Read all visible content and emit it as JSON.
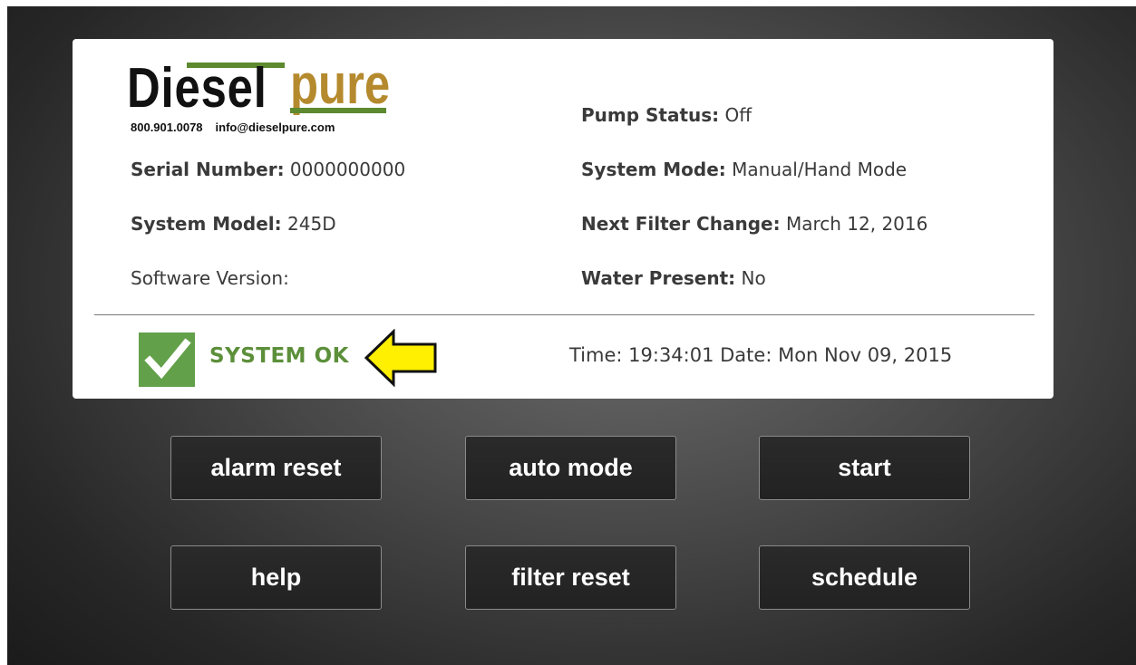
{
  "brand": {
    "name_part1": "Diesel",
    "name_part2": "pure",
    "phone": "800.901.0078",
    "email": "info@dieselpure.com",
    "colors": {
      "diesel": "#111111",
      "pure": "#b58a2e",
      "bar": "#5d8a2f"
    }
  },
  "info": {
    "serial_label": "Serial Number:",
    "serial_value": "0000000000",
    "model_label": "System Model:",
    "model_value": "245D",
    "software_label": "Software Version:",
    "pump_label": "Pump Status:",
    "pump_value": "Off",
    "mode_label": "System Mode:",
    "mode_value": "Manual/Hand Mode",
    "filter_label": "Next Filter Change:",
    "filter_value": "March 12, 2016",
    "water_label": "Water Present:",
    "water_value": "No"
  },
  "status": {
    "text": "SYSTEM OK",
    "icon": "check-icon",
    "arrow_icon": "arrow-left-icon",
    "color": "#62a04a",
    "arrow_color": "#ffef00",
    "time_text": "Time: 19:34:01 Date: Mon Nov 09, 2015"
  },
  "buttons": {
    "alarm_reset": "alarm reset",
    "auto_mode": "auto mode",
    "start": "start",
    "help": "help",
    "filter_reset": "filter reset",
    "schedule": "schedule"
  }
}
